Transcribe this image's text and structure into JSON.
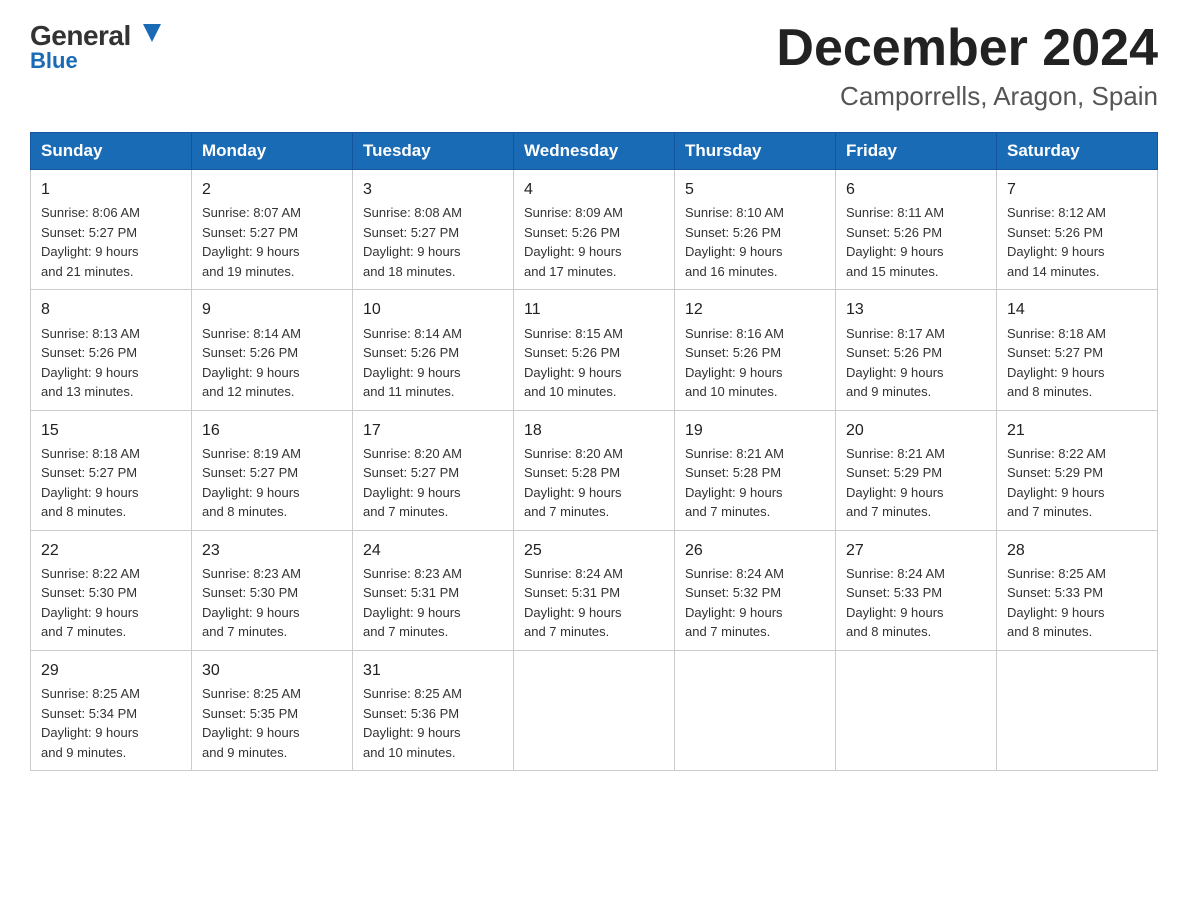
{
  "logo": {
    "general": "General",
    "triangle": "▶",
    "blue": "Blue"
  },
  "title": "December 2024",
  "location": "Camporrells, Aragon, Spain",
  "headers": [
    "Sunday",
    "Monday",
    "Tuesday",
    "Wednesday",
    "Thursday",
    "Friday",
    "Saturday"
  ],
  "weeks": [
    [
      {
        "day": "1",
        "sunrise": "8:06 AM",
        "sunset": "5:27 PM",
        "daylight": "9 hours and 21 minutes."
      },
      {
        "day": "2",
        "sunrise": "8:07 AM",
        "sunset": "5:27 PM",
        "daylight": "9 hours and 19 minutes."
      },
      {
        "day": "3",
        "sunrise": "8:08 AM",
        "sunset": "5:27 PM",
        "daylight": "9 hours and 18 minutes."
      },
      {
        "day": "4",
        "sunrise": "8:09 AM",
        "sunset": "5:26 PM",
        "daylight": "9 hours and 17 minutes."
      },
      {
        "day": "5",
        "sunrise": "8:10 AM",
        "sunset": "5:26 PM",
        "daylight": "9 hours and 16 minutes."
      },
      {
        "day": "6",
        "sunrise": "8:11 AM",
        "sunset": "5:26 PM",
        "daylight": "9 hours and 15 minutes."
      },
      {
        "day": "7",
        "sunrise": "8:12 AM",
        "sunset": "5:26 PM",
        "daylight": "9 hours and 14 minutes."
      }
    ],
    [
      {
        "day": "8",
        "sunrise": "8:13 AM",
        "sunset": "5:26 PM",
        "daylight": "9 hours and 13 minutes."
      },
      {
        "day": "9",
        "sunrise": "8:14 AM",
        "sunset": "5:26 PM",
        "daylight": "9 hours and 12 minutes."
      },
      {
        "day": "10",
        "sunrise": "8:14 AM",
        "sunset": "5:26 PM",
        "daylight": "9 hours and 11 minutes."
      },
      {
        "day": "11",
        "sunrise": "8:15 AM",
        "sunset": "5:26 PM",
        "daylight": "9 hours and 10 minutes."
      },
      {
        "day": "12",
        "sunrise": "8:16 AM",
        "sunset": "5:26 PM",
        "daylight": "9 hours and 10 minutes."
      },
      {
        "day": "13",
        "sunrise": "8:17 AM",
        "sunset": "5:26 PM",
        "daylight": "9 hours and 9 minutes."
      },
      {
        "day": "14",
        "sunrise": "8:18 AM",
        "sunset": "5:27 PM",
        "daylight": "9 hours and 8 minutes."
      }
    ],
    [
      {
        "day": "15",
        "sunrise": "8:18 AM",
        "sunset": "5:27 PM",
        "daylight": "9 hours and 8 minutes."
      },
      {
        "day": "16",
        "sunrise": "8:19 AM",
        "sunset": "5:27 PM",
        "daylight": "9 hours and 8 minutes."
      },
      {
        "day": "17",
        "sunrise": "8:20 AM",
        "sunset": "5:27 PM",
        "daylight": "9 hours and 7 minutes."
      },
      {
        "day": "18",
        "sunrise": "8:20 AM",
        "sunset": "5:28 PM",
        "daylight": "9 hours and 7 minutes."
      },
      {
        "day": "19",
        "sunrise": "8:21 AM",
        "sunset": "5:28 PM",
        "daylight": "9 hours and 7 minutes."
      },
      {
        "day": "20",
        "sunrise": "8:21 AM",
        "sunset": "5:29 PM",
        "daylight": "9 hours and 7 minutes."
      },
      {
        "day": "21",
        "sunrise": "8:22 AM",
        "sunset": "5:29 PM",
        "daylight": "9 hours and 7 minutes."
      }
    ],
    [
      {
        "day": "22",
        "sunrise": "8:22 AM",
        "sunset": "5:30 PM",
        "daylight": "9 hours and 7 minutes."
      },
      {
        "day": "23",
        "sunrise": "8:23 AM",
        "sunset": "5:30 PM",
        "daylight": "9 hours and 7 minutes."
      },
      {
        "day": "24",
        "sunrise": "8:23 AM",
        "sunset": "5:31 PM",
        "daylight": "9 hours and 7 minutes."
      },
      {
        "day": "25",
        "sunrise": "8:24 AM",
        "sunset": "5:31 PM",
        "daylight": "9 hours and 7 minutes."
      },
      {
        "day": "26",
        "sunrise": "8:24 AM",
        "sunset": "5:32 PM",
        "daylight": "9 hours and 7 minutes."
      },
      {
        "day": "27",
        "sunrise": "8:24 AM",
        "sunset": "5:33 PM",
        "daylight": "9 hours and 8 minutes."
      },
      {
        "day": "28",
        "sunrise": "8:25 AM",
        "sunset": "5:33 PM",
        "daylight": "9 hours and 8 minutes."
      }
    ],
    [
      {
        "day": "29",
        "sunrise": "8:25 AM",
        "sunset": "5:34 PM",
        "daylight": "9 hours and 9 minutes."
      },
      {
        "day": "30",
        "sunrise": "8:25 AM",
        "sunset": "5:35 PM",
        "daylight": "9 hours and 9 minutes."
      },
      {
        "day": "31",
        "sunrise": "8:25 AM",
        "sunset": "5:36 PM",
        "daylight": "9 hours and 10 minutes."
      },
      null,
      null,
      null,
      null
    ]
  ],
  "labels": {
    "sunrise": "Sunrise:",
    "sunset": "Sunset:",
    "daylight": "Daylight:"
  }
}
